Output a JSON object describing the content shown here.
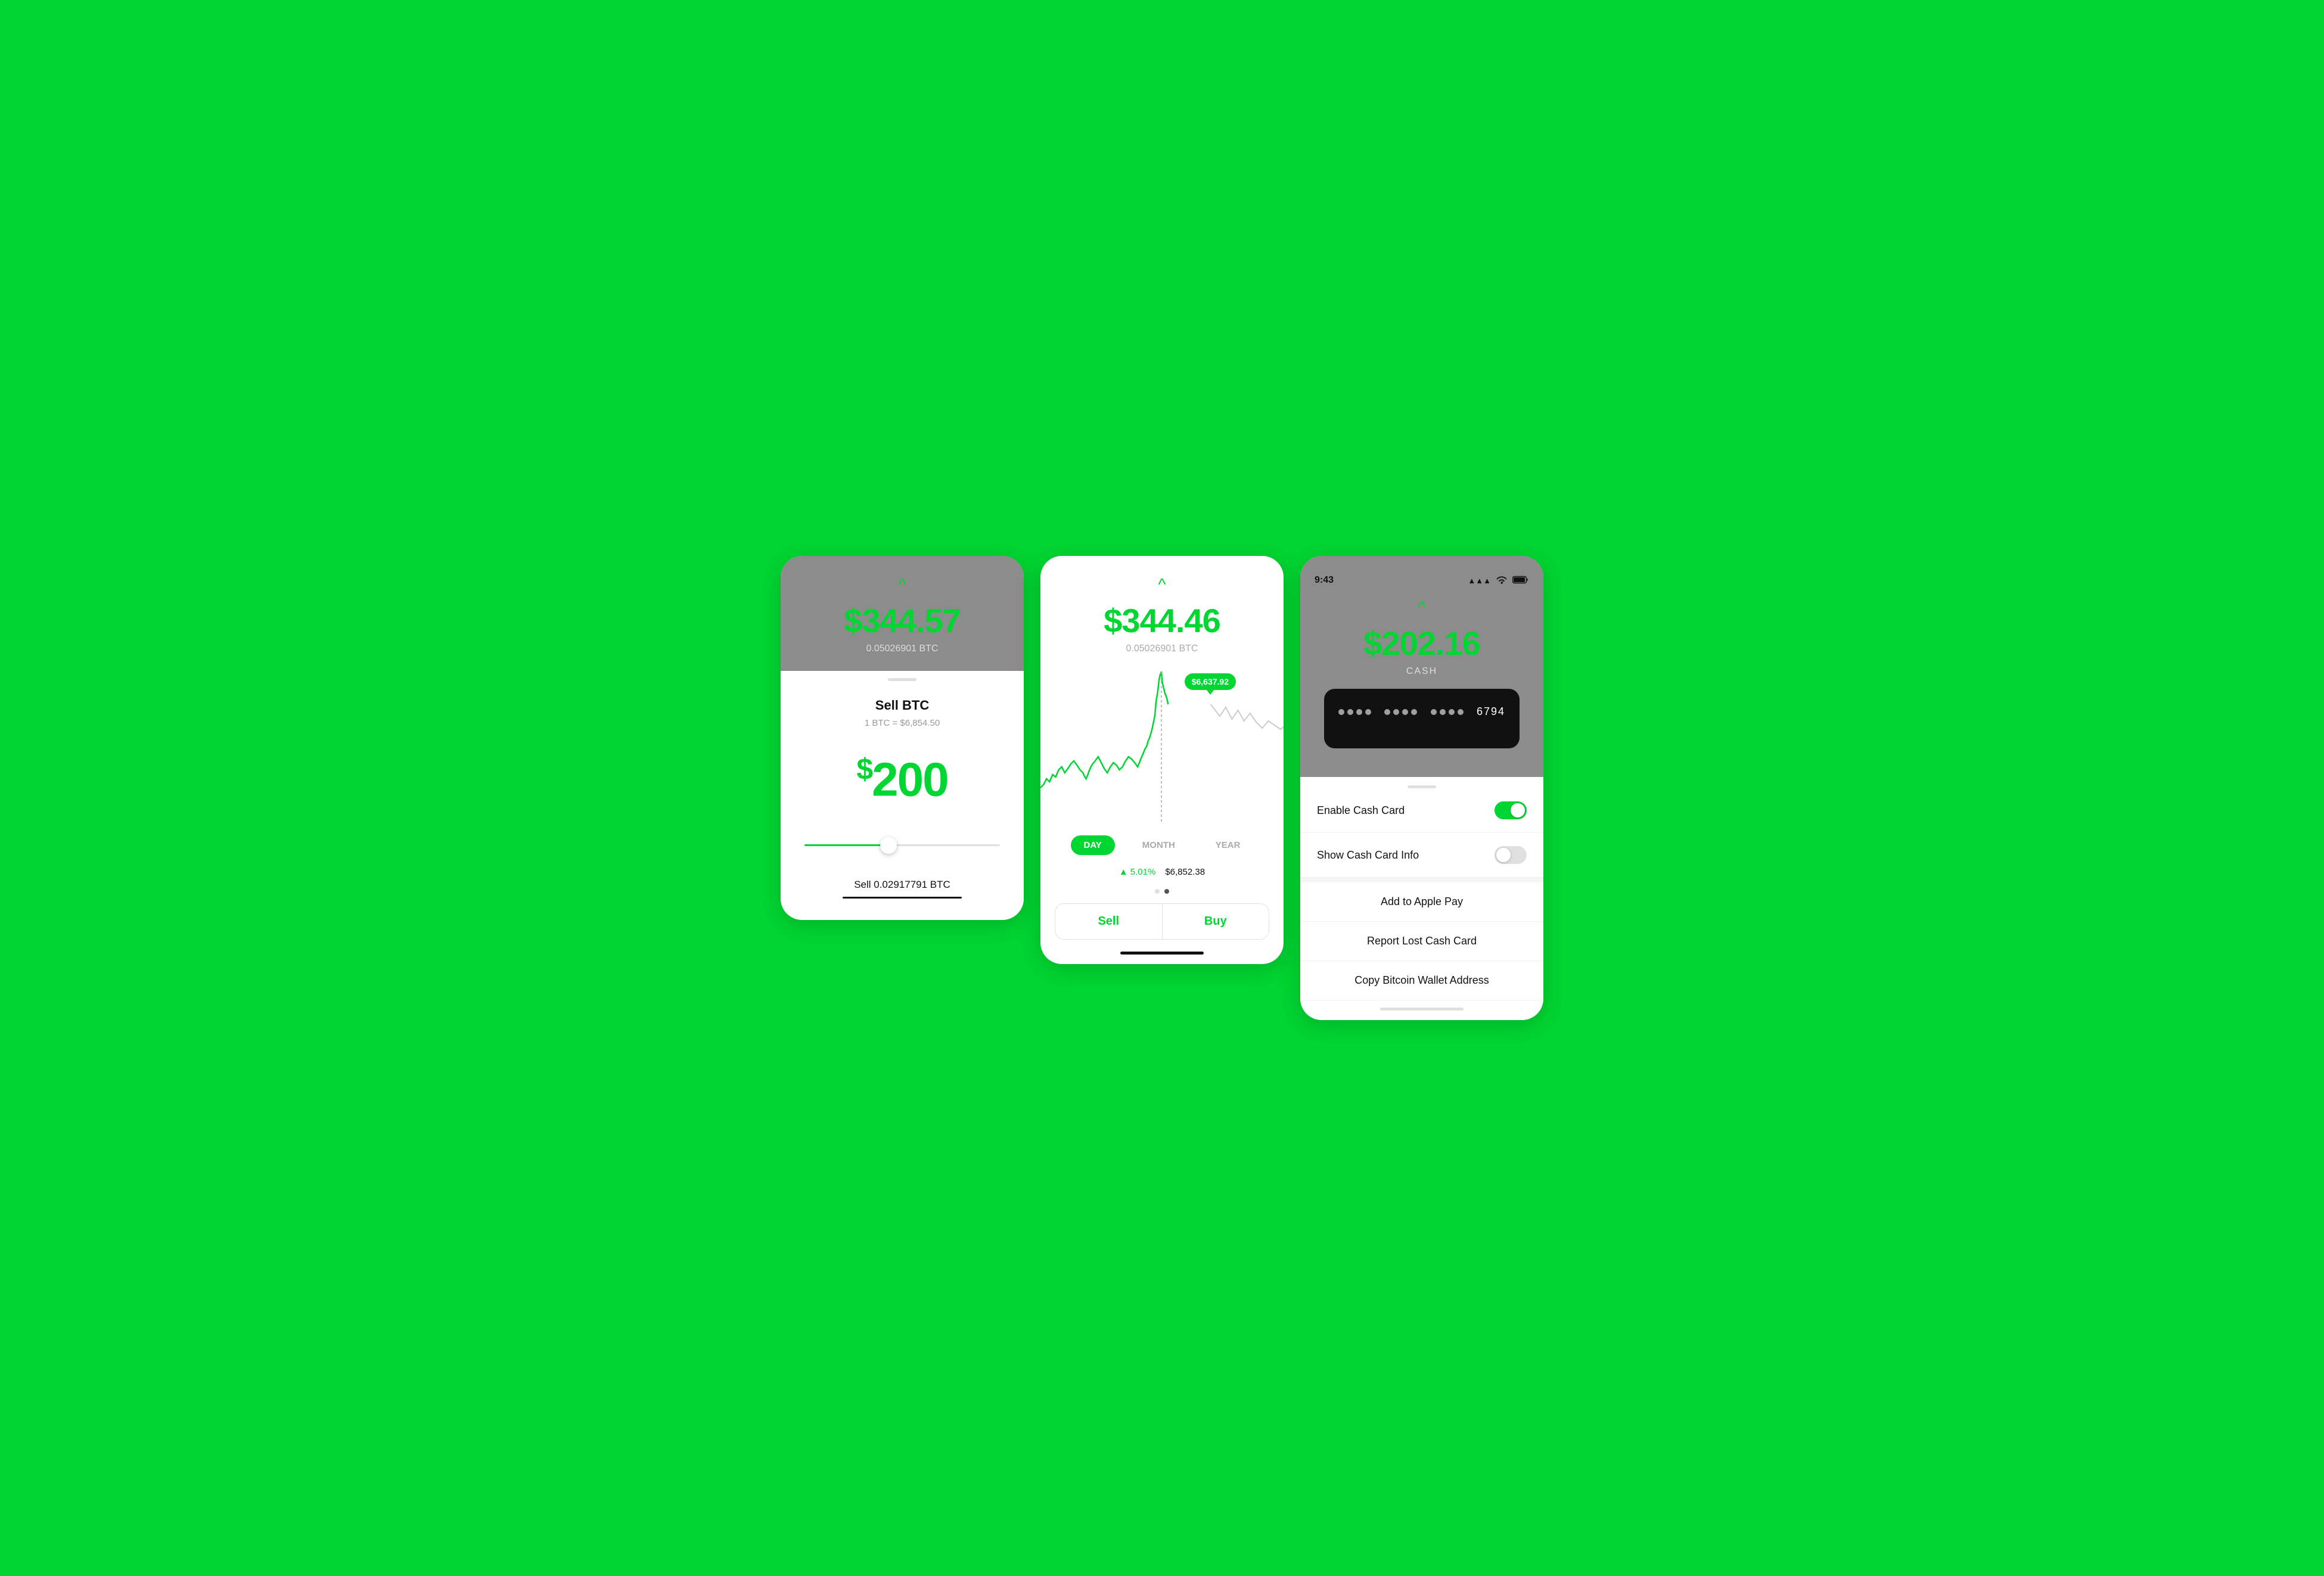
{
  "app": {
    "background_color": "#00D632",
    "accent_color": "#00D632"
  },
  "screen1": {
    "top": {
      "chevron": "^",
      "amount": "$344.57",
      "btc_amount": "0.05026901 BTC"
    },
    "bottom": {
      "title": "Sell BTC",
      "rate": "1 BTC = $6,854.50",
      "sell_amount": "200",
      "sell_amount_dollar": "$",
      "btc_sell_label": "Sell 0.02917791 BTC"
    }
  },
  "screen2": {
    "top": {
      "chevron": "^",
      "price": "$344.46",
      "btc_amount": "0.05026901 BTC"
    },
    "chart": {
      "tooltip_value": "$6,637.92"
    },
    "time_tabs": [
      {
        "label": "DAY",
        "active": true
      },
      {
        "label": "MONTH",
        "active": false
      },
      {
        "label": "YEAR",
        "active": false
      }
    ],
    "stats": {
      "pct": "5.01%",
      "value": "$6,852.38"
    },
    "buttons": {
      "sell": "Sell",
      "buy": "Buy"
    }
  },
  "screen3": {
    "status_bar": {
      "time": "9:43",
      "signal": "●●●",
      "wifi": "wifi",
      "battery": "battery"
    },
    "top": {
      "chevron": "^",
      "amount": "$202.16",
      "label": "CASH"
    },
    "card": {
      "last4": "6794",
      "dots_groups": 3
    },
    "menu": {
      "enable_cash_card": "Enable Cash Card",
      "enable_cash_card_on": true,
      "show_cash_card_info": "Show Cash Card Info",
      "show_cash_card_info_on": false,
      "add_to_apple_pay": "Add to Apple Pay",
      "report_lost": "Report Lost Cash Card",
      "copy_bitcoin": "Copy Bitcoin Wallet Address"
    }
  }
}
